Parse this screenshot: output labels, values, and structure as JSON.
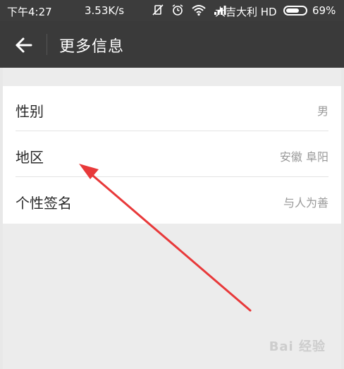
{
  "status_bar": {
    "time": "下午4:27",
    "speed": "3.53K/s",
    "carrier": "大吉大利 HD",
    "battery_pct": "69%",
    "battery_level": 0.69
  },
  "app_bar": {
    "title": "更多信息"
  },
  "rows": [
    {
      "label": "性别",
      "value": "男"
    },
    {
      "label": "地区",
      "value": "安徽 阜阳"
    },
    {
      "label": "个性签名",
      "value": "与人为善"
    }
  ],
  "watermark": "Bai 经验",
  "colors": {
    "toolbar": "#3a3a3a",
    "background": "#ececec",
    "arrow": "#e8393a"
  }
}
